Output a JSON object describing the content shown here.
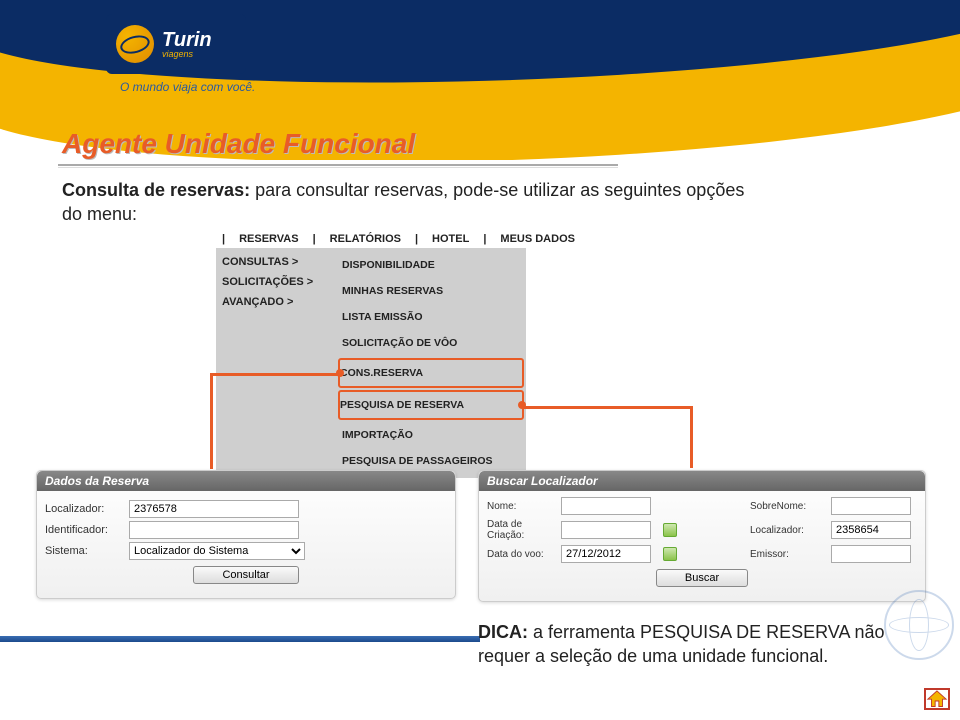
{
  "brand": {
    "name": "Turin",
    "sub": "viagens",
    "tagline": "O mundo viaja com você."
  },
  "page_title": "Agente Unidade Funcional",
  "intro": {
    "bold": "Consulta de reservas:",
    "rest": " para consultar reservas, pode-se utilizar as seguintes opções do menu:"
  },
  "menu": {
    "top": [
      "RESERVAS",
      "RELATÓRIOS",
      "HOTEL",
      "MEUS DADOS"
    ],
    "left": [
      "CONSULTAS >",
      "SOLICITAÇÕES >",
      "AVANÇADO >"
    ],
    "right": [
      "DISPONIBILIDADE",
      "MINHAS RESERVAS",
      "LISTA EMISSÃO",
      "SOLICITAÇÃO DE VÔO",
      "CONS.RESERVA",
      "PESQUISA DE RESERVA",
      "IMPORTAÇÃO",
      "PESQUISA DE PASSAGEIROS"
    ]
  },
  "dados_panel": {
    "title": "Dados da Reserva",
    "labels": {
      "localizador": "Localizador:",
      "identificador": "Identificador:",
      "sistema": "Sistema:"
    },
    "values": {
      "localizador": "2376578",
      "identificador": "",
      "sistema": "Localizador do Sistema"
    },
    "button": "Consultar"
  },
  "buscar_panel": {
    "title": "Buscar Localizador",
    "labels": {
      "nome": "Nome:",
      "sobrenome": "SobreNome:",
      "data_criacao": "Data de Criação:",
      "localizador": "Localizador:",
      "data_voo": "Data do voo:",
      "emissor": "Emissor:"
    },
    "values": {
      "nome": "",
      "sobrenome": "",
      "data_criacao": "",
      "localizador": "2358654",
      "data_voo": "27/12/2012",
      "emissor": ""
    },
    "button": "Buscar"
  },
  "dica": {
    "bold": "DICA:",
    "rest": " a ferramenta PESQUISA DE RESERVA não requer a seleção de uma unidade funcional."
  },
  "icons": {
    "home": "home-icon",
    "calendar": "calendar-icon"
  }
}
